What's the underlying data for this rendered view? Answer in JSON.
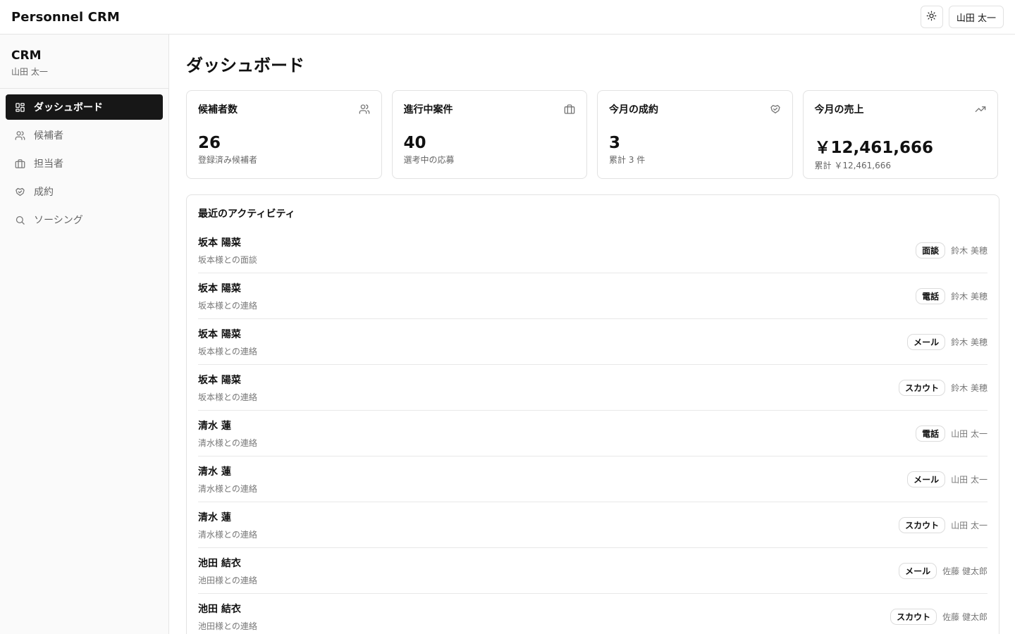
{
  "header": {
    "app_title": "Personnel CRM",
    "theme_icon": "sun-icon",
    "user_label": "山田 太一"
  },
  "sidebar": {
    "brand": "CRM",
    "user": "山田 太一",
    "items": [
      {
        "label": "ダッシュボード",
        "icon": "dashboard-grid-icon",
        "active": true
      },
      {
        "label": "候補者",
        "icon": "users-icon",
        "active": false
      },
      {
        "label": "担当者",
        "icon": "briefcase-icon",
        "active": false
      },
      {
        "label": "成約",
        "icon": "handshake-icon",
        "active": false
      },
      {
        "label": "ソーシング",
        "icon": "search-icon",
        "active": false
      }
    ]
  },
  "main": {
    "page_title": "ダッシュボード",
    "stats": [
      {
        "title": "候補者数",
        "icon": "users-icon",
        "value": "26",
        "sub": "登録済み候補者"
      },
      {
        "title": "進行中案件",
        "icon": "briefcase-icon",
        "value": "40",
        "sub": "選考中の応募"
      },
      {
        "title": "今月の成約",
        "icon": "handshake-icon",
        "value": "3",
        "sub": "累計 3 件"
      },
      {
        "title": "今月の売上",
        "icon": "trending-up-icon",
        "value": "￥12,461,666",
        "sub": "累計 ￥12,461,666"
      }
    ],
    "activity": {
      "title": "最近のアクティビティ",
      "rows": [
        {
          "name": "坂本 陽菜",
          "desc": "坂本様との面談",
          "type": "面談",
          "assignee": "鈴木 美穂"
        },
        {
          "name": "坂本 陽菜",
          "desc": "坂本様との連絡",
          "type": "電話",
          "assignee": "鈴木 美穂"
        },
        {
          "name": "坂本 陽菜",
          "desc": "坂本様との連絡",
          "type": "メール",
          "assignee": "鈴木 美穂"
        },
        {
          "name": "坂本 陽菜",
          "desc": "坂本様との連絡",
          "type": "スカウト",
          "assignee": "鈴木 美穂"
        },
        {
          "name": "清水 蓮",
          "desc": "清水様との連絡",
          "type": "電話",
          "assignee": "山田 太一"
        },
        {
          "name": "清水 蓮",
          "desc": "清水様との連絡",
          "type": "メール",
          "assignee": "山田 太一"
        },
        {
          "name": "清水 蓮",
          "desc": "清水様との連絡",
          "type": "スカウト",
          "assignee": "山田 太一"
        },
        {
          "name": "池田 結衣",
          "desc": "池田様との連絡",
          "type": "メール",
          "assignee": "佐藤 健太郎"
        },
        {
          "name": "池田 結衣",
          "desc": "池田様との連絡",
          "type": "スカウト",
          "assignee": "佐藤 健太郎"
        }
      ]
    }
  }
}
